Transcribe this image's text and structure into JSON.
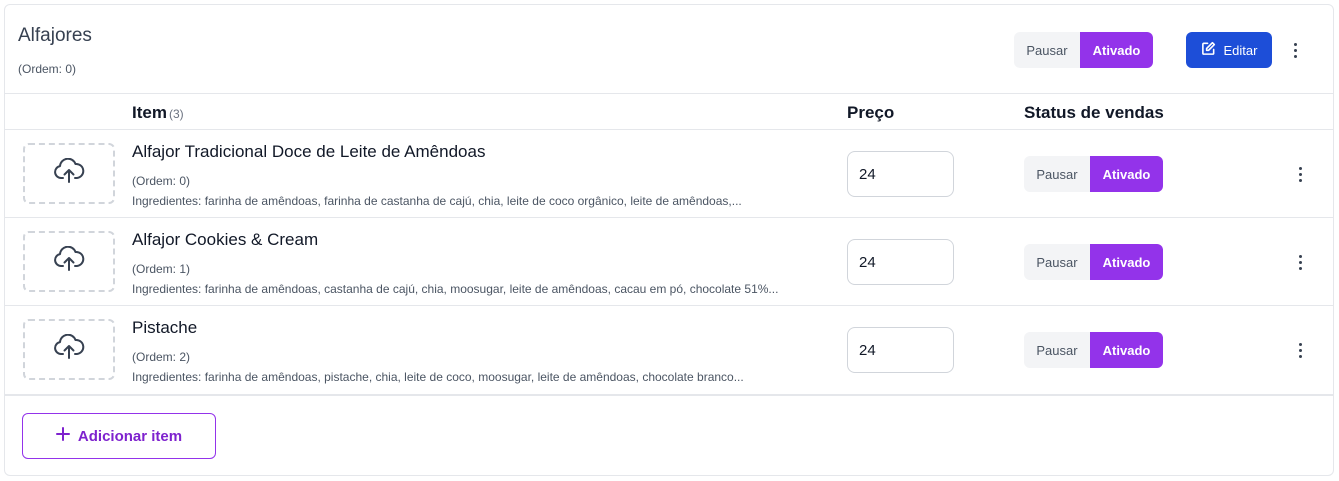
{
  "category": {
    "title": "Alfajores",
    "order": "(Ordem: 0)",
    "toggle": {
      "off_label": "Pausar",
      "on_label": "Ativado"
    },
    "edit_label": "Editar"
  },
  "table": {
    "headers": {
      "item": "Item",
      "item_count": "(3)",
      "price": "Preço",
      "status": "Status de vendas"
    },
    "rows": [
      {
        "name": "Alfajor Tradicional Doce de Leite de Amêndoas",
        "order": "(Ordem: 0)",
        "ingredients": "Ingredientes: farinha de amêndoas, farinha de castanha de cajú, chia, leite de coco orgânico, leite de amêndoas,...",
        "price": "24",
        "off_label": "Pausar",
        "on_label": "Ativado"
      },
      {
        "name": "Alfajor Cookies & Cream",
        "order": "(Ordem: 1)",
        "ingredients": "Ingredientes: farinha de amêndoas, castanha de cajú, chia, moosugar, leite de amêndoas, cacau em pó, chocolate 51%...",
        "price": "24",
        "off_label": "Pausar",
        "on_label": "Ativado"
      },
      {
        "name": "Pistache",
        "order": "(Ordem: 2)",
        "ingredients": "Ingredientes: farinha de amêndoas, pistache, chia, leite de coco, moosugar, leite de amêndoas, chocolate branco...",
        "price": "24",
        "off_label": "Pausar",
        "on_label": "Ativado"
      }
    ]
  },
  "add_item_label": "Adicionar item",
  "icons": {
    "upload": "cloud-upload-icon",
    "edit": "pencil-square-icon",
    "more": "more-vertical-icon",
    "add": "plus-icon"
  },
  "colors": {
    "accent": "#9333ea",
    "edit_button": "#1d4ed8",
    "pause_bg": "#f3f4f6"
  }
}
